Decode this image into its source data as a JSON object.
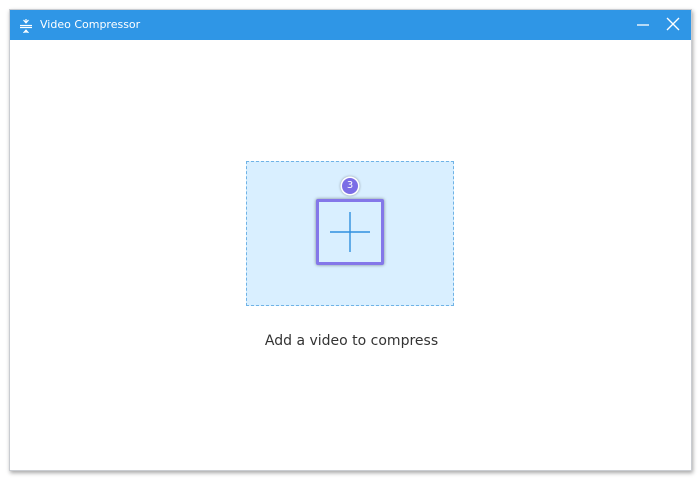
{
  "window": {
    "title": "Video Compressor",
    "app_icon": "compress-icon",
    "controls": {
      "minimize_icon": "minimize-icon",
      "close_icon": "close-icon"
    }
  },
  "dropzone": {
    "add_icon": "plus-icon",
    "step_badge": "3",
    "caption": "Add a video to compress"
  },
  "colors": {
    "titlebar": "#2f96e6",
    "dropzone_fill": "#d9efff",
    "dropzone_border": "#6fb3e6",
    "highlight": "#8477e9",
    "plus": "#2f8fdf",
    "caption_text": "#333333"
  }
}
